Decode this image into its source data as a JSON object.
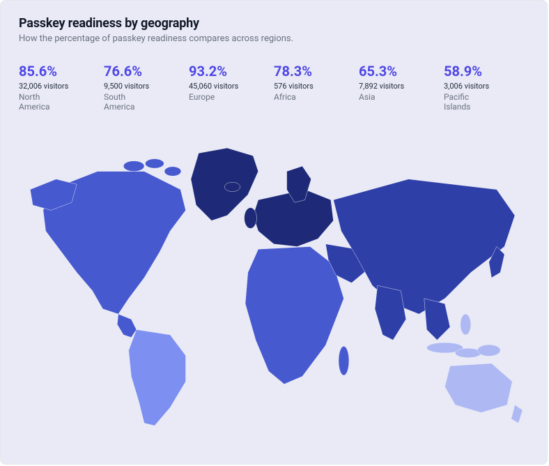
{
  "header": {
    "title": "Passkey readiness by geography",
    "subtitle": "How the percentage of passkey readiness compares across regions."
  },
  "stats": [
    {
      "percent": "85.6%",
      "visitors": "32,006 visitors",
      "region": "North America"
    },
    {
      "percent": "76.6%",
      "visitors": "9,500 visitors",
      "region": "South America"
    },
    {
      "percent": "93.2%",
      "visitors": "45,060 visitors",
      "region": "Europe"
    },
    {
      "percent": "78.3%",
      "visitors": "576 visitors",
      "region": "Africa"
    },
    {
      "percent": "65.3%",
      "visitors": "7,892 visitors",
      "region": "Asia"
    },
    {
      "percent": "58.9%",
      "visitors": "3,006 visitors",
      "region": "Pacific Islands"
    }
  ],
  "colors": {
    "accent": "#4f46e5",
    "map_darkest": "#1e2a78",
    "map_dark": "#2f3fa8",
    "map_mid": "#4759cf",
    "map_light": "#7d8ff0",
    "map_lightest": "#aeb9f3"
  },
  "chart_data": {
    "type": "choropleth",
    "title": "Passkey readiness by geography",
    "metric": "Passkey readiness %",
    "regions": [
      {
        "name": "North America",
        "percent": 85.6,
        "visitors": 32006
      },
      {
        "name": "South America",
        "percent": 76.6,
        "visitors": 9500
      },
      {
        "name": "Europe",
        "percent": 93.2,
        "visitors": 45060
      },
      {
        "name": "Africa",
        "percent": 78.3,
        "visitors": 576
      },
      {
        "name": "Asia",
        "percent": 65.3,
        "visitors": 7892
      },
      {
        "name": "Pacific Islands",
        "percent": 58.9,
        "visitors": 3006
      }
    ],
    "range": [
      0,
      100
    ]
  }
}
